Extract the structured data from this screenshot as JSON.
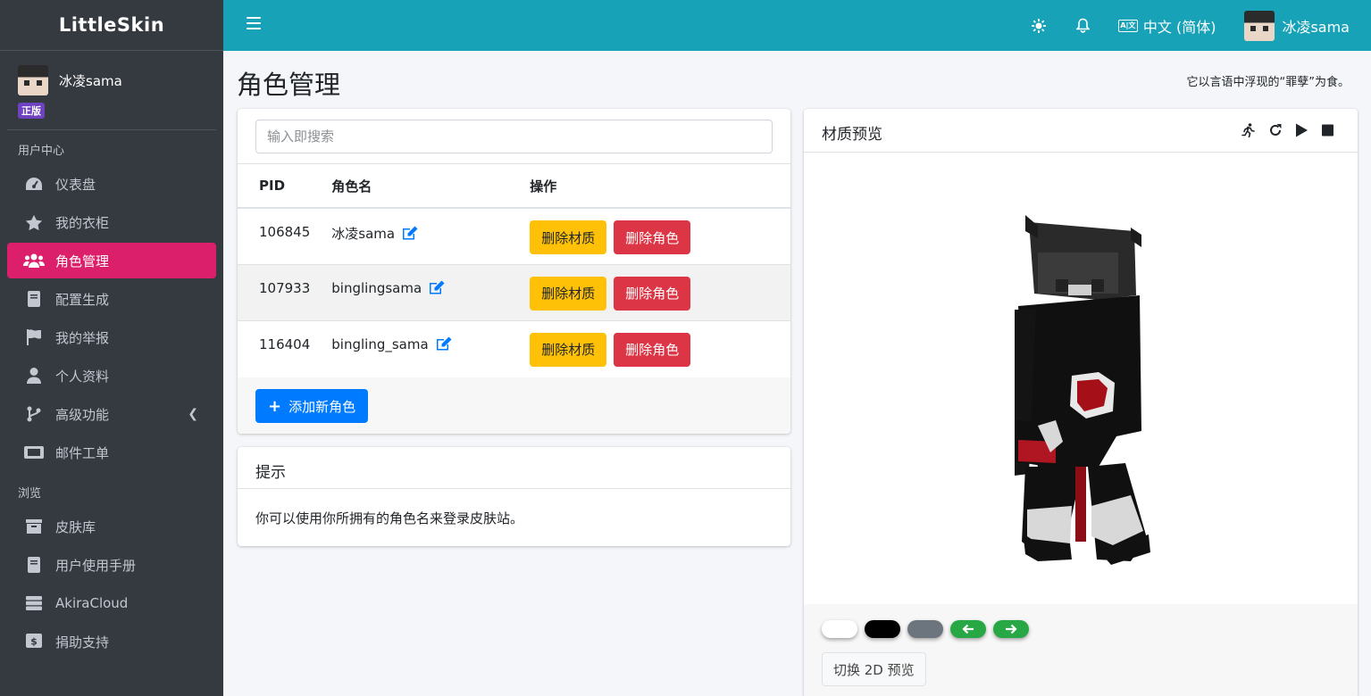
{
  "brand": "LittleSkin",
  "user": {
    "name": "冰凌sama",
    "badge": "正版"
  },
  "sidebar": {
    "section_user": "用户中心",
    "section_browse": "浏览",
    "items": [
      {
        "label": "仪表盘",
        "icon": "dashboard-icon"
      },
      {
        "label": "我的衣柜",
        "icon": "star-icon"
      },
      {
        "label": "角色管理",
        "icon": "users-icon",
        "active": true
      },
      {
        "label": "配置生成",
        "icon": "book-icon"
      },
      {
        "label": "我的举报",
        "icon": "flag-icon"
      },
      {
        "label": "个人资料",
        "icon": "user-icon"
      },
      {
        "label": "高级功能",
        "icon": "branch-icon"
      },
      {
        "label": "邮件工单",
        "icon": "ticket-icon"
      }
    ],
    "browse_items": [
      {
        "label": "皮肤库",
        "icon": "archive-icon"
      },
      {
        "label": "用户使用手册",
        "icon": "book-icon"
      },
      {
        "label": "AkiraCloud",
        "icon": "server-icon"
      },
      {
        "label": "捐助支持",
        "icon": "dollar-icon"
      }
    ]
  },
  "topbar": {
    "language": "中文 (简体)",
    "lang_icon_text": "A|文",
    "user_name": "冰凌sama"
  },
  "page": {
    "title": "角色管理",
    "motto": "它以言语中浮现的“罪孽”为食。"
  },
  "players": {
    "search_placeholder": "输入即搜索",
    "columns": [
      "PID",
      "角色名",
      "操作"
    ],
    "rows": [
      {
        "pid": "106845",
        "name": "冰凌sama"
      },
      {
        "pid": "107933",
        "name": "binglingsama"
      },
      {
        "pid": "116404",
        "name": "bingling_sama"
      }
    ],
    "delete_texture_label": "删除材质",
    "delete_player_label": "删除角色",
    "add_label": "添加新角色"
  },
  "tips": {
    "title": "提示",
    "body": "你可以使用你所拥有的角色名来登录皮肤站。"
  },
  "preview": {
    "title": "材质预览",
    "toggle_label": "切换 2D 预览",
    "swatch_colors": [
      "#ffffff",
      "#000000",
      "#6c757d"
    ],
    "nav_color": "#28a745"
  },
  "colors": {
    "sidebar_bg": "#343a40",
    "topbar_bg": "#17a2b8",
    "active": "#dc1f6a",
    "warning": "#ffc107",
    "danger": "#dc3545",
    "primary": "#007bff",
    "edit_icon": "#007bff"
  }
}
